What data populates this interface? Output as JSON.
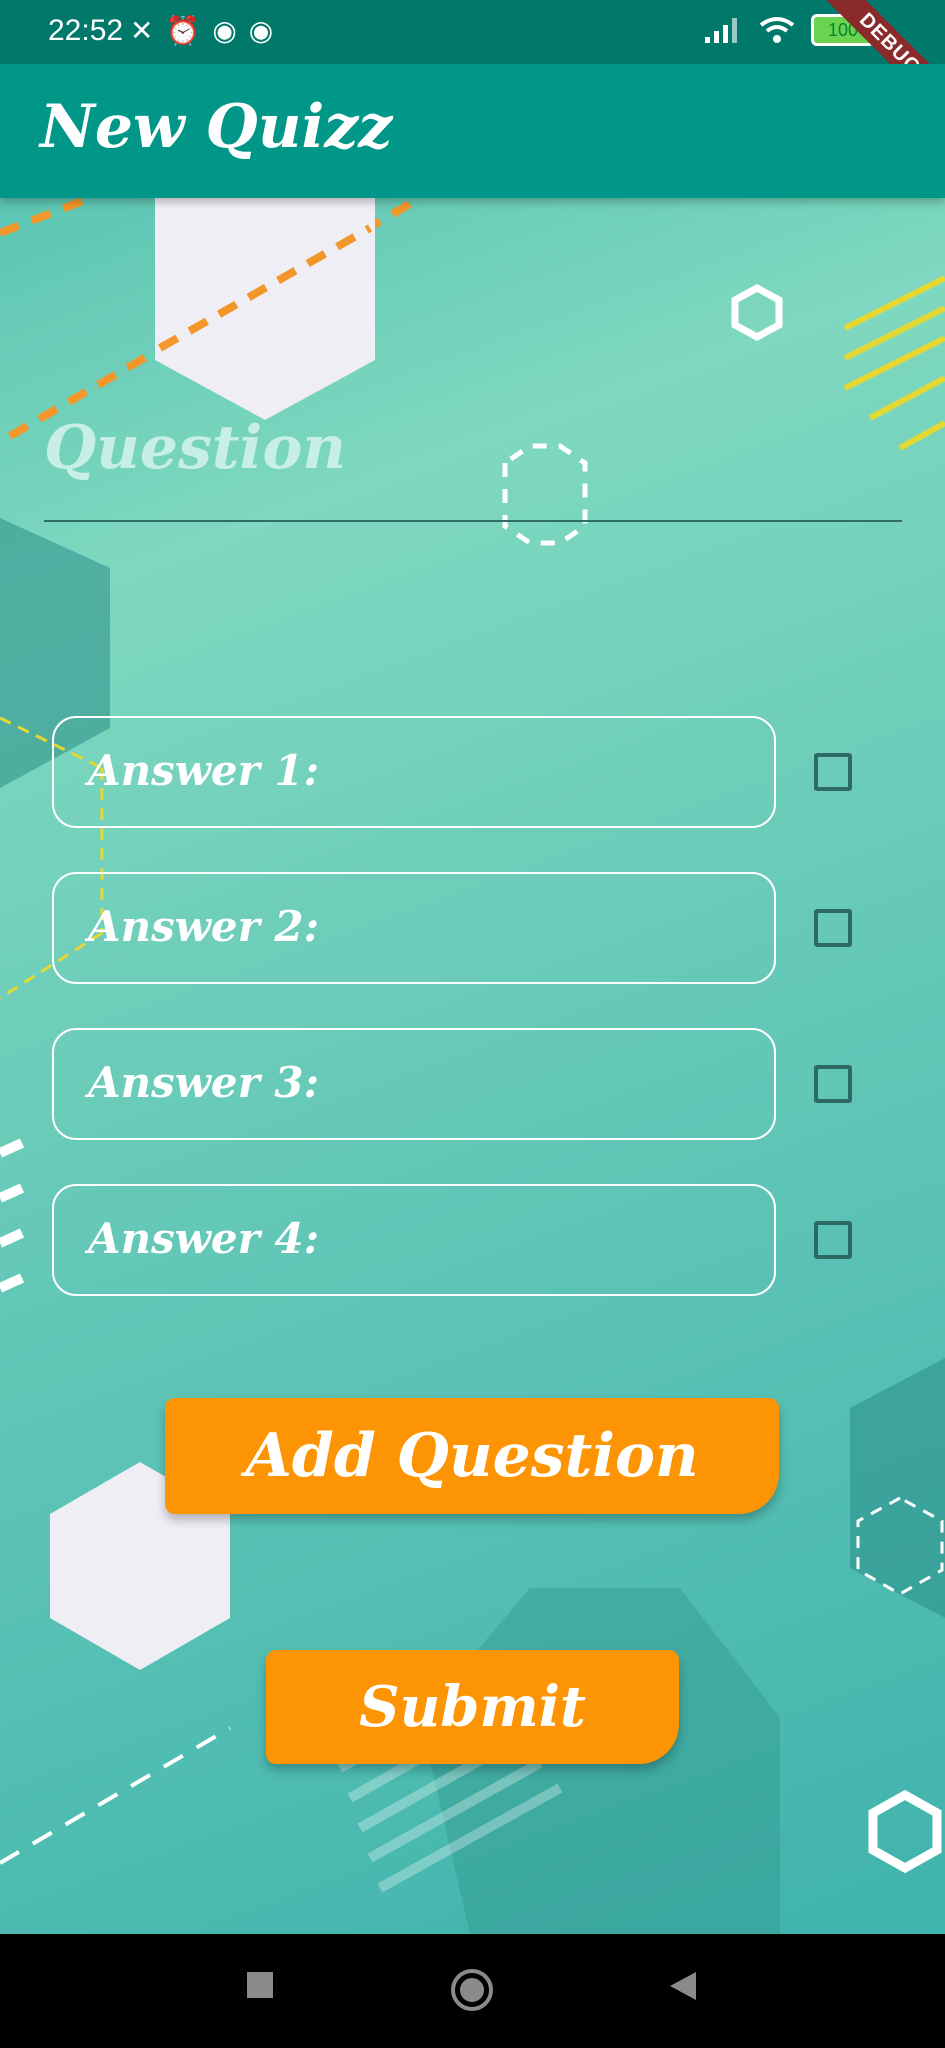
{
  "status_bar": {
    "time": "22:52",
    "battery": "100",
    "icons": [
      "vibrate-off-icon",
      "alarm-icon",
      "notification-icon",
      "notification-icon",
      "signal-icon",
      "wifi-icon",
      "battery-icon"
    ]
  },
  "debug_banner": "DEBUG",
  "app_bar": {
    "title": "New Quizz"
  },
  "question": {
    "label": "Question"
  },
  "answers": [
    {
      "label": "Answer 1:"
    },
    {
      "label": "Answer 2:"
    },
    {
      "label": "Answer 3:"
    },
    {
      "label": "Answer 4:"
    }
  ],
  "buttons": {
    "add_question": "Add Question",
    "submit": "Submit"
  },
  "nav_bar": {
    "icons": [
      "recent-apps-icon",
      "home-icon",
      "back-icon"
    ]
  },
  "colors": {
    "app_bar": "#009688",
    "button": "#fd9404",
    "background": "#66c9b8"
  }
}
